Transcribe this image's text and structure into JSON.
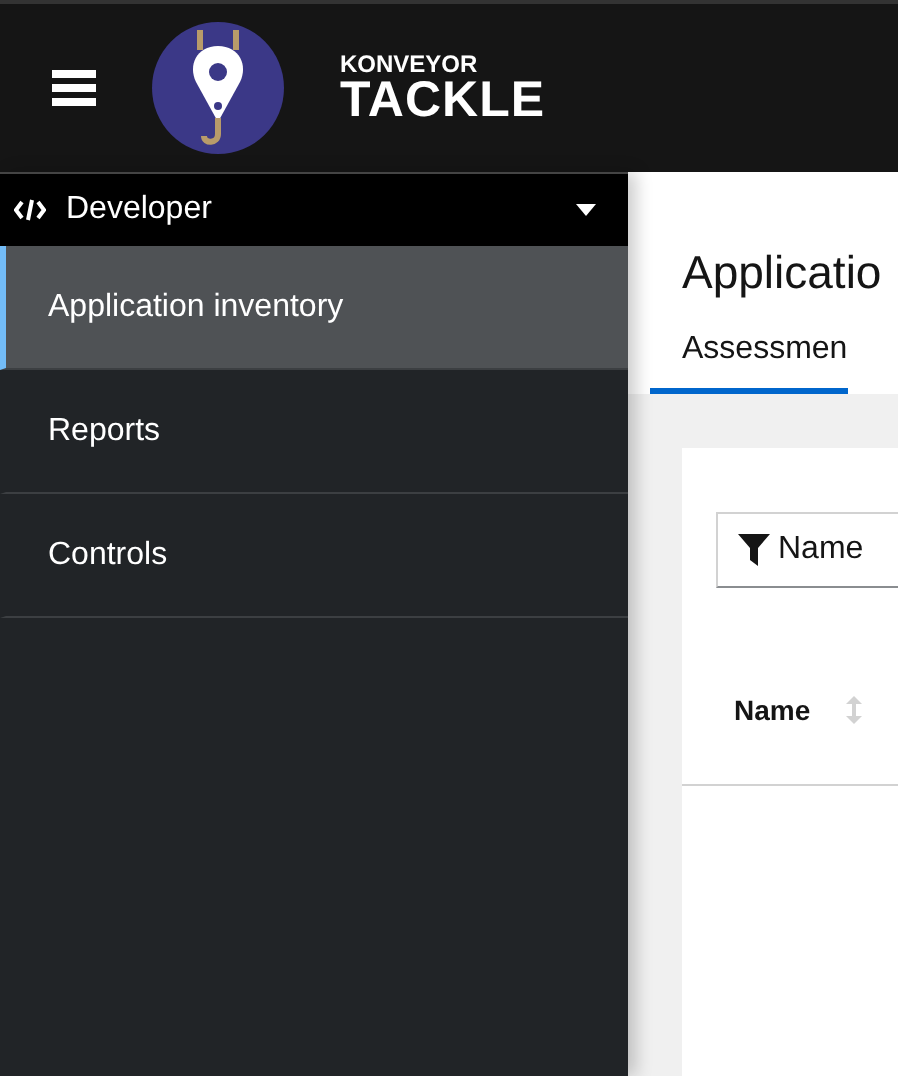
{
  "header": {
    "brand_small": "KONVEYOR",
    "brand_large": "TACKLE"
  },
  "perspective": {
    "label": "Developer"
  },
  "nav": [
    {
      "label": "Application inventory",
      "selected": true
    },
    {
      "label": "Reports",
      "selected": false
    },
    {
      "label": "Controls",
      "selected": false
    }
  ],
  "page": {
    "title": "Applicatio",
    "tabs": [
      {
        "label": "Assessmen",
        "selected": true
      }
    ]
  },
  "toolbar": {
    "filter_label": "Name"
  },
  "table": {
    "columns": [
      {
        "label": "Name"
      }
    ]
  }
}
